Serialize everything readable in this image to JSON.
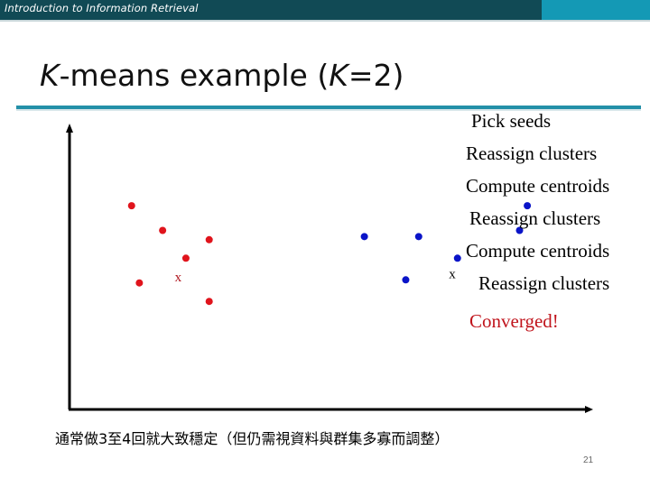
{
  "header": {
    "course_title": "Introduction to Information Retrieval",
    "bar_color": "#114a55",
    "accent_color": "#1499b5"
  },
  "slide": {
    "title_k": "K",
    "title_mid": "-means example (",
    "title_k2": "K",
    "title_end": "=2)",
    "page_number": "21"
  },
  "steps": [
    {
      "label": "Pick seeds",
      "status": "normal"
    },
    {
      "label": "Reassign clusters",
      "status": "normal"
    },
    {
      "label": "Compute centroids",
      "status": "normal"
    },
    {
      "label": "Reassign clusters",
      "status": "normal"
    },
    {
      "label": "Compute centroids",
      "status": "normal"
    },
    {
      "label": "Reassign clusters",
      "status": "normal"
    },
    {
      "label": "Converged!",
      "status": "final"
    }
  ],
  "note": "通常做3至4回就大致穩定（但仍需視資料與群集多寡而調整）",
  "diagram": {
    "axes": "x-y arrows, no ticks or labels",
    "clusters": [
      {
        "name": "red",
        "color": "#e0141c",
        "centroid_label": "x",
        "centroid_color": "#b01820",
        "centroid": [
          2.6,
          5.3
        ],
        "points": [
          [
            1.7,
            7.6
          ],
          [
            2.3,
            6.8
          ],
          [
            3.2,
            6.5
          ],
          [
            2.75,
            5.9
          ],
          [
            1.85,
            5.1
          ],
          [
            3.2,
            4.5
          ]
        ]
      },
      {
        "name": "blue",
        "color": "#0a14c8",
        "centroid_label": "x",
        "centroid_color": "#000000",
        "centroid": [
          7.9,
          5.4
        ],
        "points": [
          [
            6.2,
            6.6
          ],
          [
            7.25,
            6.6
          ],
          [
            9.2,
            6.8
          ],
          [
            9.35,
            7.6
          ],
          [
            8.0,
            5.9
          ],
          [
            7.0,
            5.2
          ]
        ]
      }
    ],
    "x_range": [
      0.5,
      10.5
    ],
    "y_range": [
      1.0,
      10.0
    ]
  }
}
